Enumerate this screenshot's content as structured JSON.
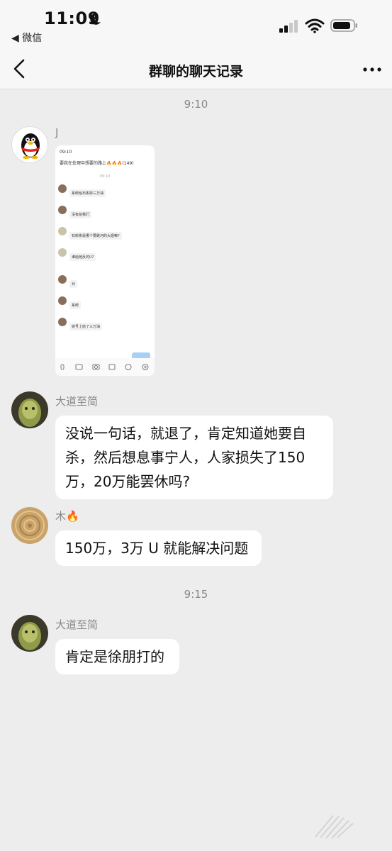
{
  "status_bar": {
    "time": "11:09",
    "back_app": "◀ 微信"
  },
  "nav": {
    "title": "群聊的聊天记录"
  },
  "timestamps": [
    "9:10",
    "9:15"
  ],
  "messages": [
    {
      "sender": "J",
      "type": "image"
    },
    {
      "sender": "大道至简",
      "text": "没说一句话，就退了，肯定知道她要自杀，然后想息事宁人，人家损失了150万，20万能罢休吗?"
    },
    {
      "sender": "木🔥",
      "text": "150万，3万 U 就能解决问题"
    },
    {
      "sender": "大道至简",
      "text": "肯定是徐朋打的"
    }
  ],
  "embedded_screenshot": {
    "status_time": "09:10",
    "title": "要我在处理中想要的路上🔥🔥🔥(149)",
    "timestamp": "09:10",
    "messages": [
      {
        "text": "系统给石彬彬三万油"
      },
      {
        "text": "没有给我们"
      },
      {
        "text": "石彬彬是哪个要跳河的大姐嘛?"
      },
      {
        "text": "谁给她反的U?"
      },
      {
        "text": "对"
      },
      {
        "text": "系统"
      },
      {
        "text": "她号上给了三万油"
      }
    ]
  }
}
